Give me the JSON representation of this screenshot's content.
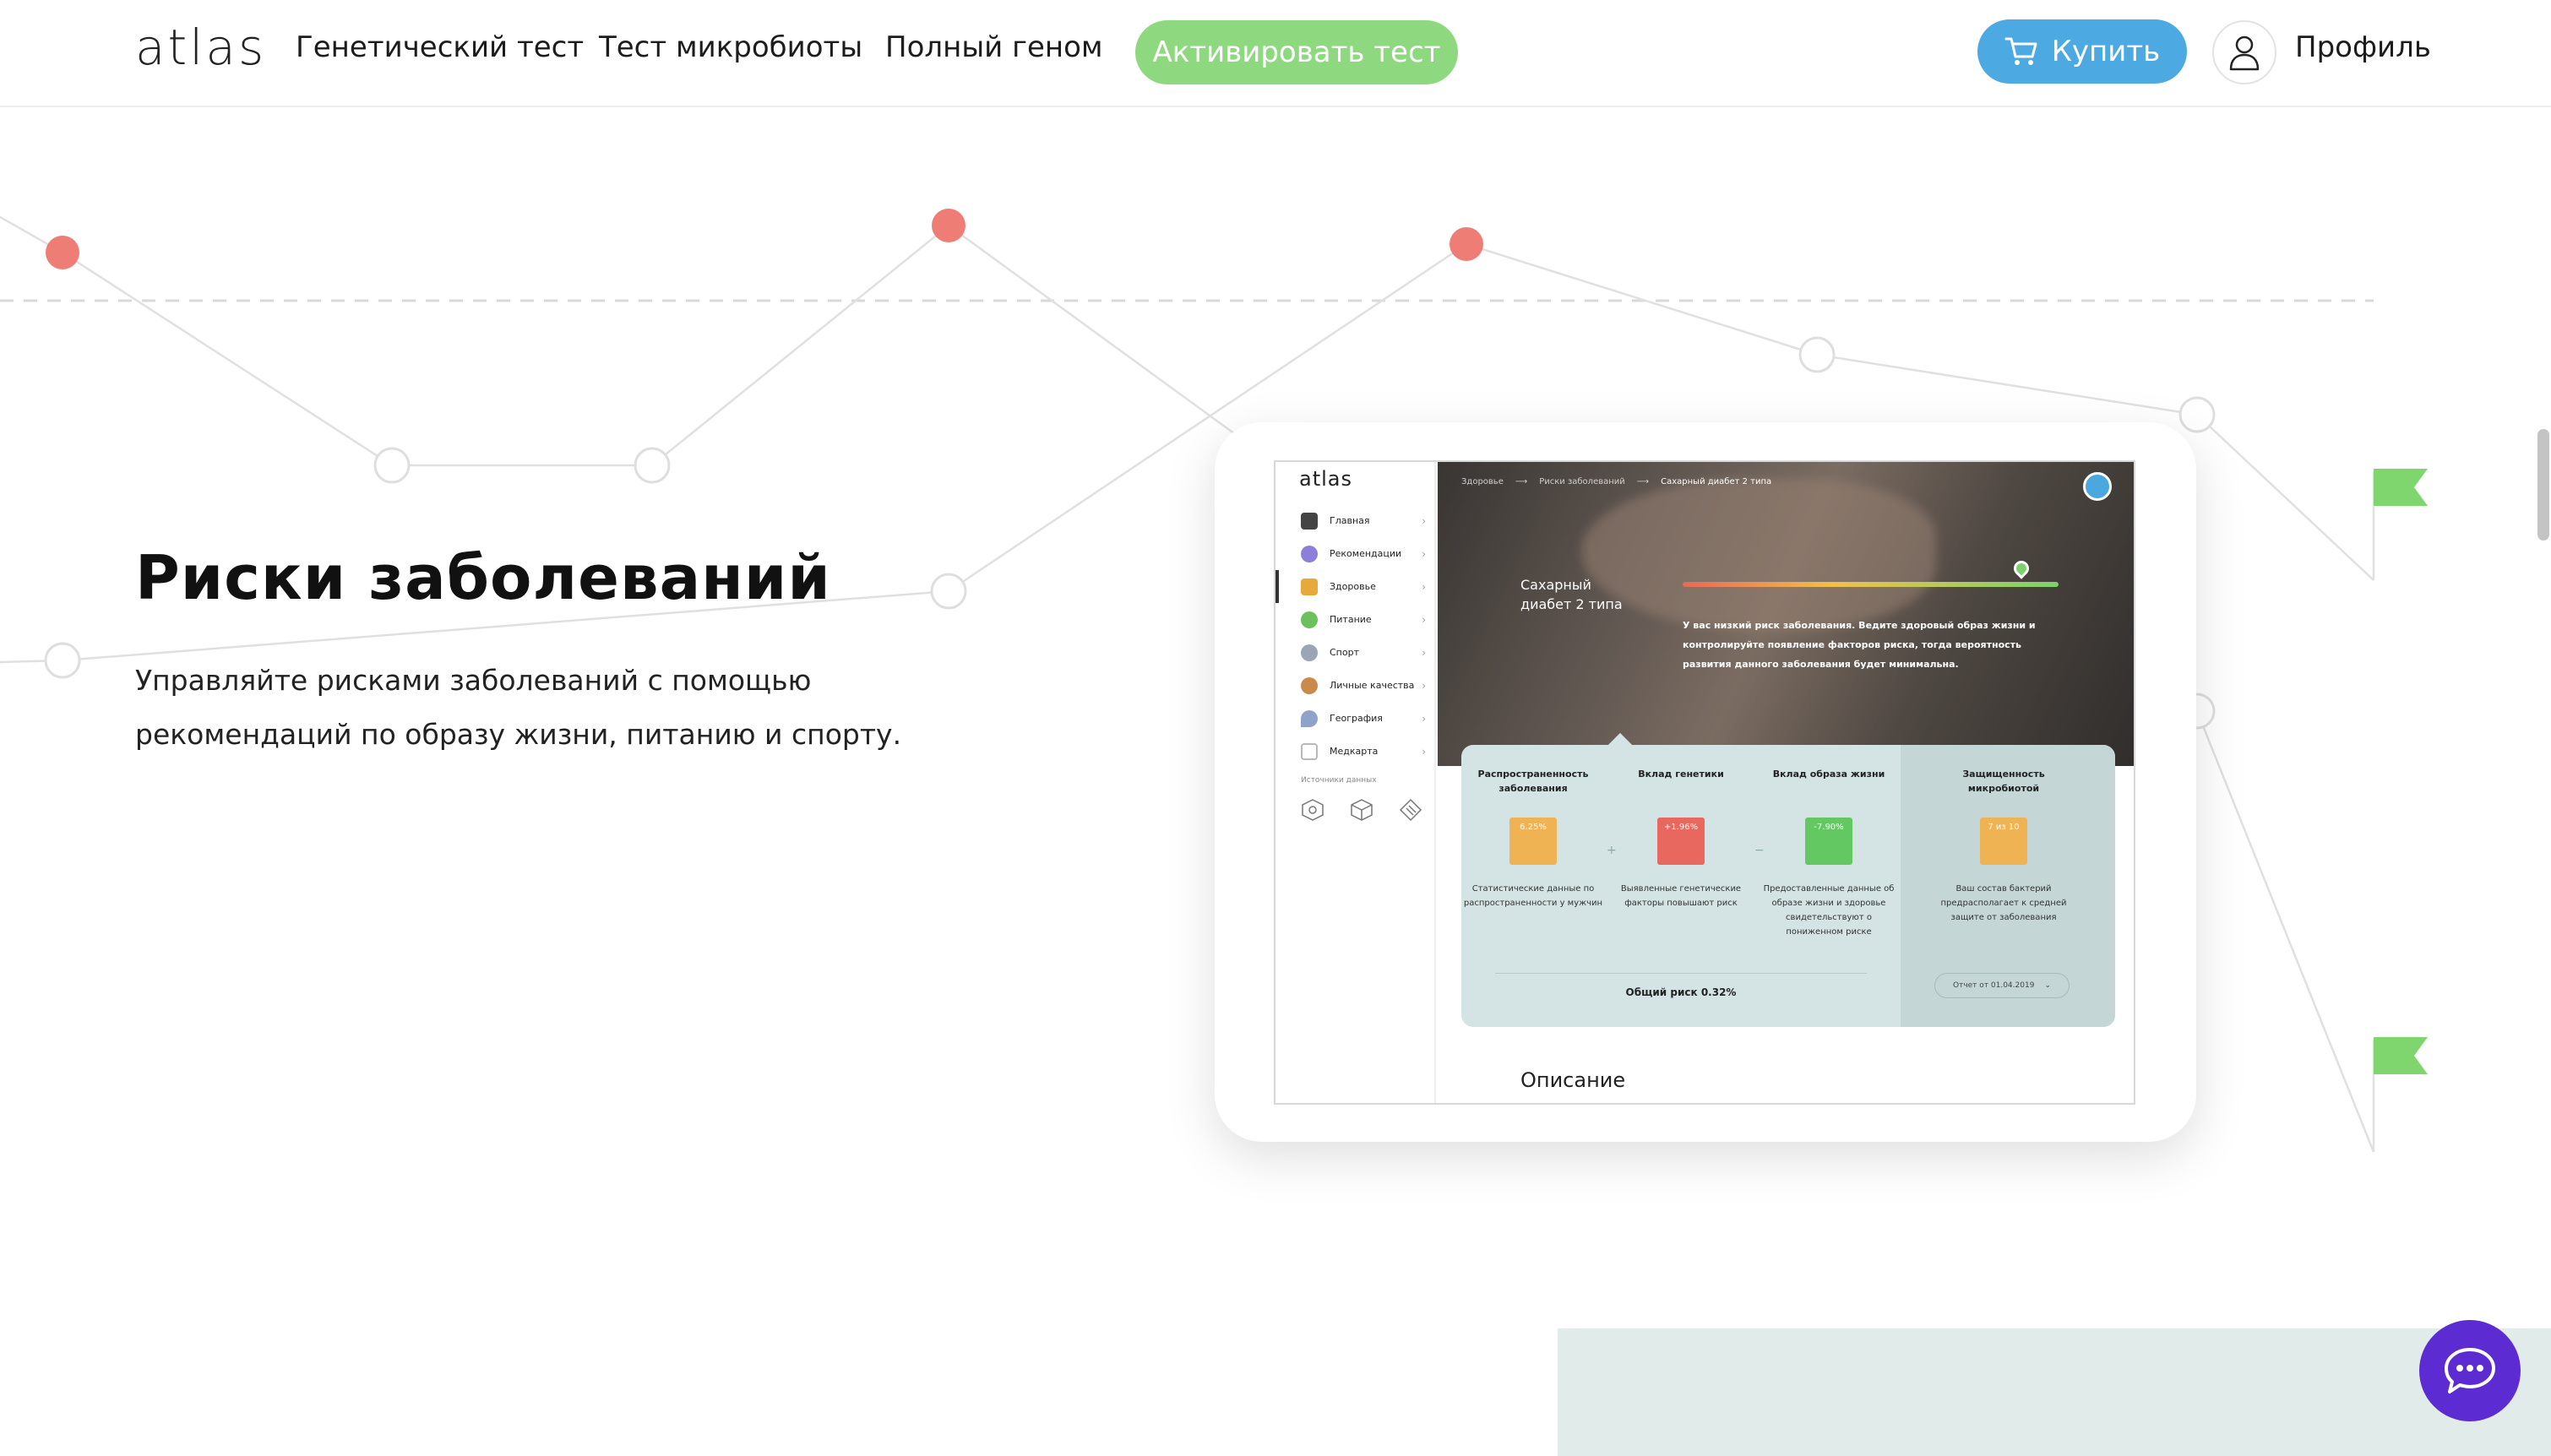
{
  "header": {
    "logo": "atlas",
    "nav": [
      "Генетический тест",
      "Тест микробиоты",
      "Полный геном"
    ],
    "activate_label": "Активировать тест",
    "buy_label": "Купить",
    "profile_label": "Профиль"
  },
  "hero": {
    "title": "Риски заболеваний",
    "description": "Управляйте рисками заболеваний с помощью рекомендаций по образу жизни, питанию и спорту."
  },
  "app": {
    "logo": "atlas",
    "menu": [
      {
        "label": "Главная",
        "icon": "home-icon",
        "color": "#444444"
      },
      {
        "label": "Рекомендации",
        "icon": "star-icon",
        "color": "#8b7fd9"
      },
      {
        "label": "Здоровье",
        "icon": "medkit-icon",
        "color": "#e8a93c"
      },
      {
        "label": "Питание",
        "icon": "broccoli-icon",
        "color": "#6cc15d"
      },
      {
        "label": "Спорт",
        "icon": "whistle-icon",
        "color": "#9aa5b5"
      },
      {
        "label": "Личные качества",
        "icon": "face-icon",
        "color": "#c98a4a"
      },
      {
        "label": "География",
        "icon": "location-icon",
        "color": "#8fa3c9"
      },
      {
        "label": "Медкарта",
        "icon": "clipboard-icon",
        "color": "#b9b9b9"
      }
    ],
    "sources_label": "Источники данных",
    "breadcrumbs": [
      "Здоровье",
      "Риски заболеваний",
      "Сахарный диабет 2 типа"
    ],
    "disease_name": "Сахарный диабет 2 типа",
    "risk_text": "У вас низкий риск заболевания. Ведите здоровый образ жизни и контролируйте появление факторов риска, тогда вероятность развития данного заболевания будет минимальна.",
    "columns": [
      {
        "title": "Распространенность заболевания",
        "value": "6.25%",
        "color": "#f0b353",
        "desc": "Статистические данные по распространенности у мужчин"
      },
      {
        "title": "Вклад генетики",
        "value": "+1.96%",
        "color": "#e8675e",
        "desc": "Выявленные генетические факторы повышают риск"
      },
      {
        "title": "Вклад образа жизни",
        "value": "-7.90%",
        "color": "#63c862",
        "desc": "Предоставленные данные об образе жизни и здоровье свидетельствуют о пониженном риске"
      },
      {
        "title": "Защищенность микробиотой",
        "value": "7 из 10",
        "color": "#f0b353",
        "desc": "Ваш состав бактерий предрасполагает к средней защите от заболевания"
      }
    ],
    "op_plus": "+",
    "op_minus": "−",
    "total_risk": "Общий риск 0.32%",
    "report_label": "Отчет от 01.04.2019",
    "section_title": "Описание"
  },
  "colors": {
    "accent_green": "#8ed97f",
    "accent_blue": "#4ca9e2",
    "chat_purple": "#5d2bd2",
    "graph_red": "#ee7d76"
  }
}
